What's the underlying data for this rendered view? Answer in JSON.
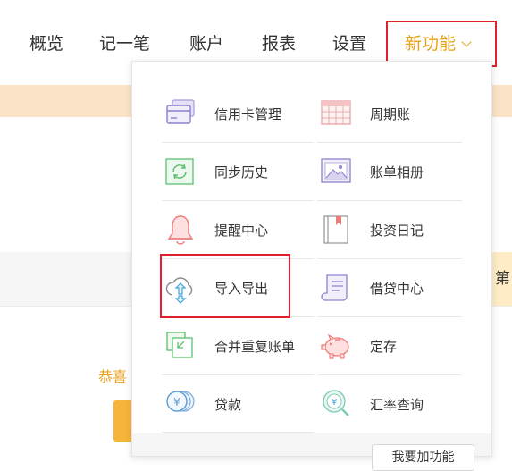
{
  "nav": {
    "items": [
      "概览",
      "记一笔",
      "账户",
      "报表",
      "设置"
    ],
    "new_feature": "新功能"
  },
  "background": {
    "congrats": "恭喜",
    "side_tab": "第"
  },
  "dropdown": {
    "left": [
      {
        "label": "信用卡管理",
        "icon": "credit-card-icon"
      },
      {
        "label": "同步历史",
        "icon": "sync-icon"
      },
      {
        "label": "提醒中心",
        "icon": "bell-icon"
      },
      {
        "label": "导入导出",
        "icon": "cloud-upload-download-icon"
      },
      {
        "label": "合并重复账单",
        "icon": "merge-icon"
      },
      {
        "label": "贷款",
        "icon": "loan-coins-icon"
      }
    ],
    "right": [
      {
        "label": "周期账",
        "icon": "calendar-icon"
      },
      {
        "label": "账单相册",
        "icon": "photo-album-icon"
      },
      {
        "label": "投资日记",
        "icon": "diary-icon"
      },
      {
        "label": "借贷中心",
        "icon": "scroll-icon"
      },
      {
        "label": "定存",
        "icon": "piggy-bank-icon"
      },
      {
        "label": "汇率查询",
        "icon": "exchange-search-icon"
      }
    ],
    "more_button": "我要加功能"
  },
  "colors": {
    "accent": "#e8a21a",
    "highlight": "#e0202a"
  }
}
